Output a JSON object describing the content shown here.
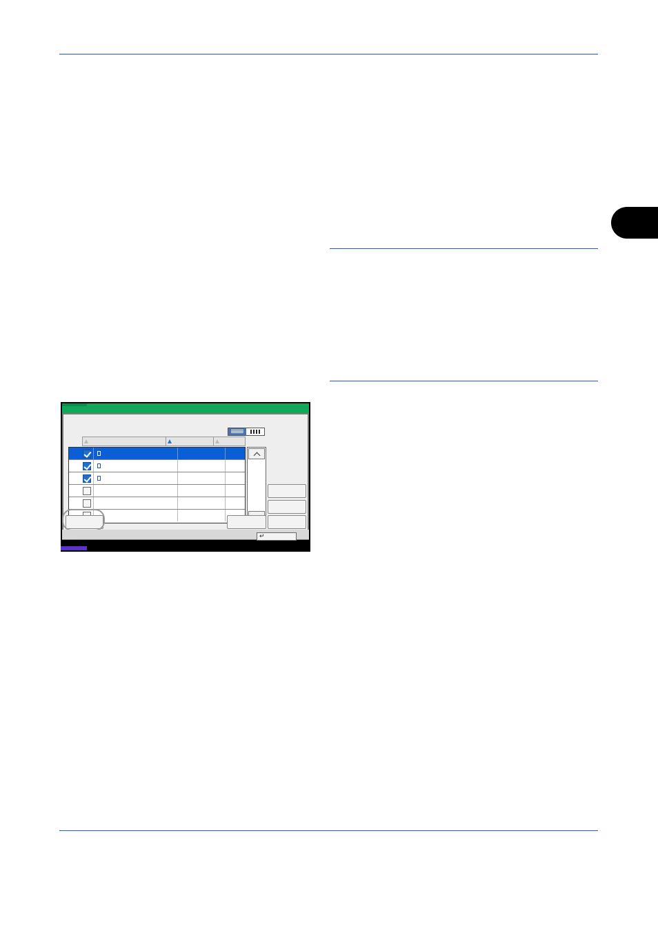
{
  "page": {
    "chapter_tab": ""
  },
  "panel": {
    "view_toggle": {
      "selected": "list",
      "list_icon": "list-view-icon",
      "thumbnail_icon": "thumbnail-view-icon"
    },
    "columns": [
      {
        "key": "name",
        "sort_icon": "sort-triangle-icon",
        "sort_active": false
      },
      {
        "key": "date",
        "sort_icon": "sort-triangle-icon",
        "sort_active": true
      },
      {
        "key": "size",
        "sort_icon": "sort-triangle-icon",
        "sort_active": false
      }
    ],
    "rows": [
      {
        "checked": true,
        "selected": true,
        "has_file": true
      },
      {
        "checked": true,
        "selected": false,
        "has_file": true
      },
      {
        "checked": true,
        "selected": false,
        "has_file": true
      },
      {
        "checked": false,
        "selected": false,
        "has_file": false
      },
      {
        "checked": false,
        "selected": false,
        "has_file": false
      },
      {
        "checked": false,
        "selected": false,
        "has_file": false
      }
    ],
    "return_glyph": "↵",
    "colors": {
      "title_bar": "#12a85a",
      "selected_row": "#0a5fd6",
      "checkbox": "#1f6fd1",
      "accent_chip": "#5a32c8",
      "rule": "#1f5fa8"
    }
  }
}
